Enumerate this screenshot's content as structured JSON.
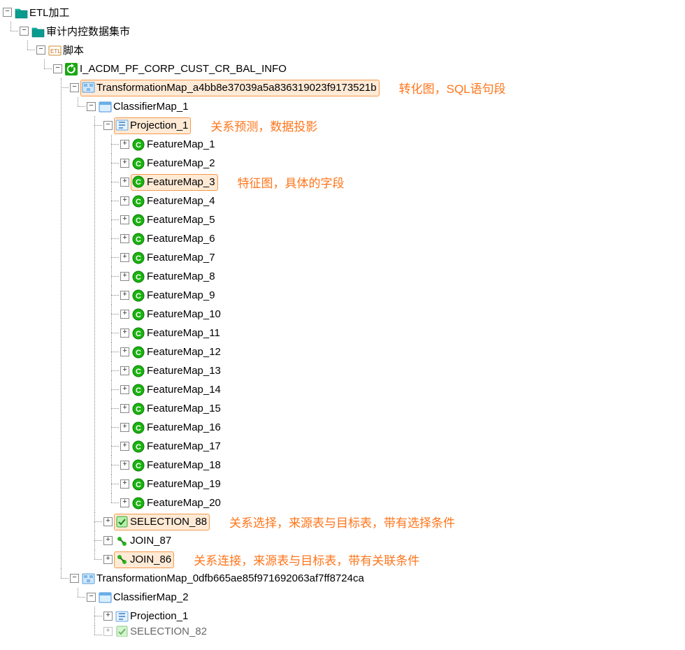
{
  "root": {
    "label": "ETL加工",
    "child": {
      "label": "审计内控数据集市",
      "child": {
        "label": "脚本",
        "child": {
          "label": "I_ACDM_PF_CORP_CUST_CR_BAL_INFO",
          "maps": [
            {
              "label": "TransformationMap_a4bb8e37039a5a836319023f9173521b",
              "annotation": "转化图，SQL语句段",
              "classifier": {
                "label": "ClassifierMap_1",
                "projection": {
                  "label": "Projection_1",
                  "annotation": "关系预测，数据投影",
                  "features": [
                    "FeatureMap_1",
                    "FeatureMap_2",
                    "FeatureMap_3",
                    "FeatureMap_4",
                    "FeatureMap_5",
                    "FeatureMap_6",
                    "FeatureMap_7",
                    "FeatureMap_8",
                    "FeatureMap_9",
                    "FeatureMap_10",
                    "FeatureMap_11",
                    "FeatureMap_12",
                    "FeatureMap_13",
                    "FeatureMap_14",
                    "FeatureMap_15",
                    "FeatureMap_16",
                    "FeatureMap_17",
                    "FeatureMap_18",
                    "FeatureMap_19",
                    "FeatureMap_20"
                  ],
                  "feature_annotation": "特征图，具体的字段"
                },
                "selection": {
                  "label": "SELECTION_88",
                  "annotation": "关系选择，来源表与目标表，带有选择条件"
                },
                "joins": [
                  {
                    "label": "JOIN_87"
                  },
                  {
                    "label": "JOIN_86",
                    "annotation": "关系连接，来源表与目标表，带有关联条件"
                  }
                ]
              }
            },
            {
              "label": "TransformationMap_0dfb665ae85f971692063af7ff8724ca",
              "classifier": {
                "label": "ClassifierMap_2",
                "projection": {
                  "label": "Projection_1"
                },
                "selection_partial": "SELECTION_82"
              }
            }
          ]
        }
      }
    }
  }
}
